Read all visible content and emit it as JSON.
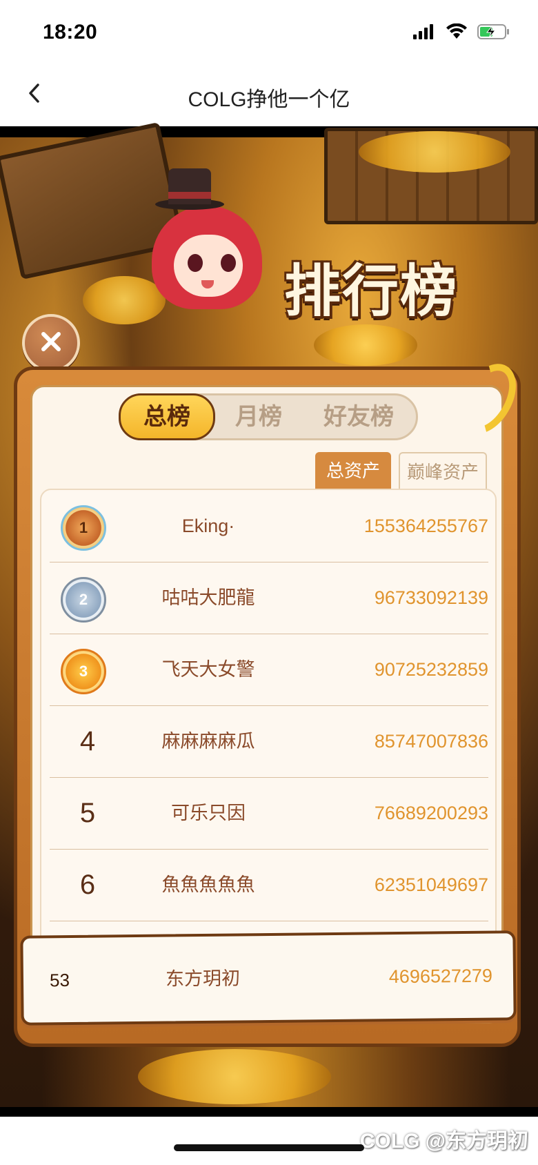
{
  "status_bar": {
    "time": "18:20",
    "icons": [
      "cellular-signal-icon",
      "wifi-icon",
      "battery-charging-icon"
    ]
  },
  "nav": {
    "title": "COLG挣他一个亿",
    "back_icon": "chevron-left-icon"
  },
  "game": {
    "banner_title": "排行榜",
    "close_icon": "close-icon",
    "tabs": [
      {
        "label": "总榜",
        "active": true
      },
      {
        "label": "月榜",
        "active": false
      },
      {
        "label": "好友榜",
        "active": false
      }
    ],
    "subtabs": [
      {
        "label": "总资产",
        "active": true
      },
      {
        "label": "巅峰资产",
        "active": false
      }
    ],
    "rows": [
      {
        "rank": "1",
        "name": "Eking·",
        "score": "155364255767"
      },
      {
        "rank": "2",
        "name": "咕咕大肥龍",
        "score": "96733092139"
      },
      {
        "rank": "3",
        "name": "飞天大女警",
        "score": "90725232859"
      },
      {
        "rank": "4",
        "name": "麻麻麻麻瓜",
        "score": "85747007836"
      },
      {
        "rank": "5",
        "name": "可乐只因",
        "score": "76689200293"
      },
      {
        "rank": "6",
        "name": "魚魚魚魚魚",
        "score": "62351049697"
      }
    ],
    "my_rank": {
      "rank": "53",
      "name": "东方玥初",
      "score": "4696527279"
    }
  },
  "watermark": "COLG @东方玥初",
  "colors": {
    "accent_gold": "#f4b52a",
    "frame_brown": "#6e3a12",
    "score_orange": "#e0942e",
    "name_brown": "#8a4a2a"
  }
}
